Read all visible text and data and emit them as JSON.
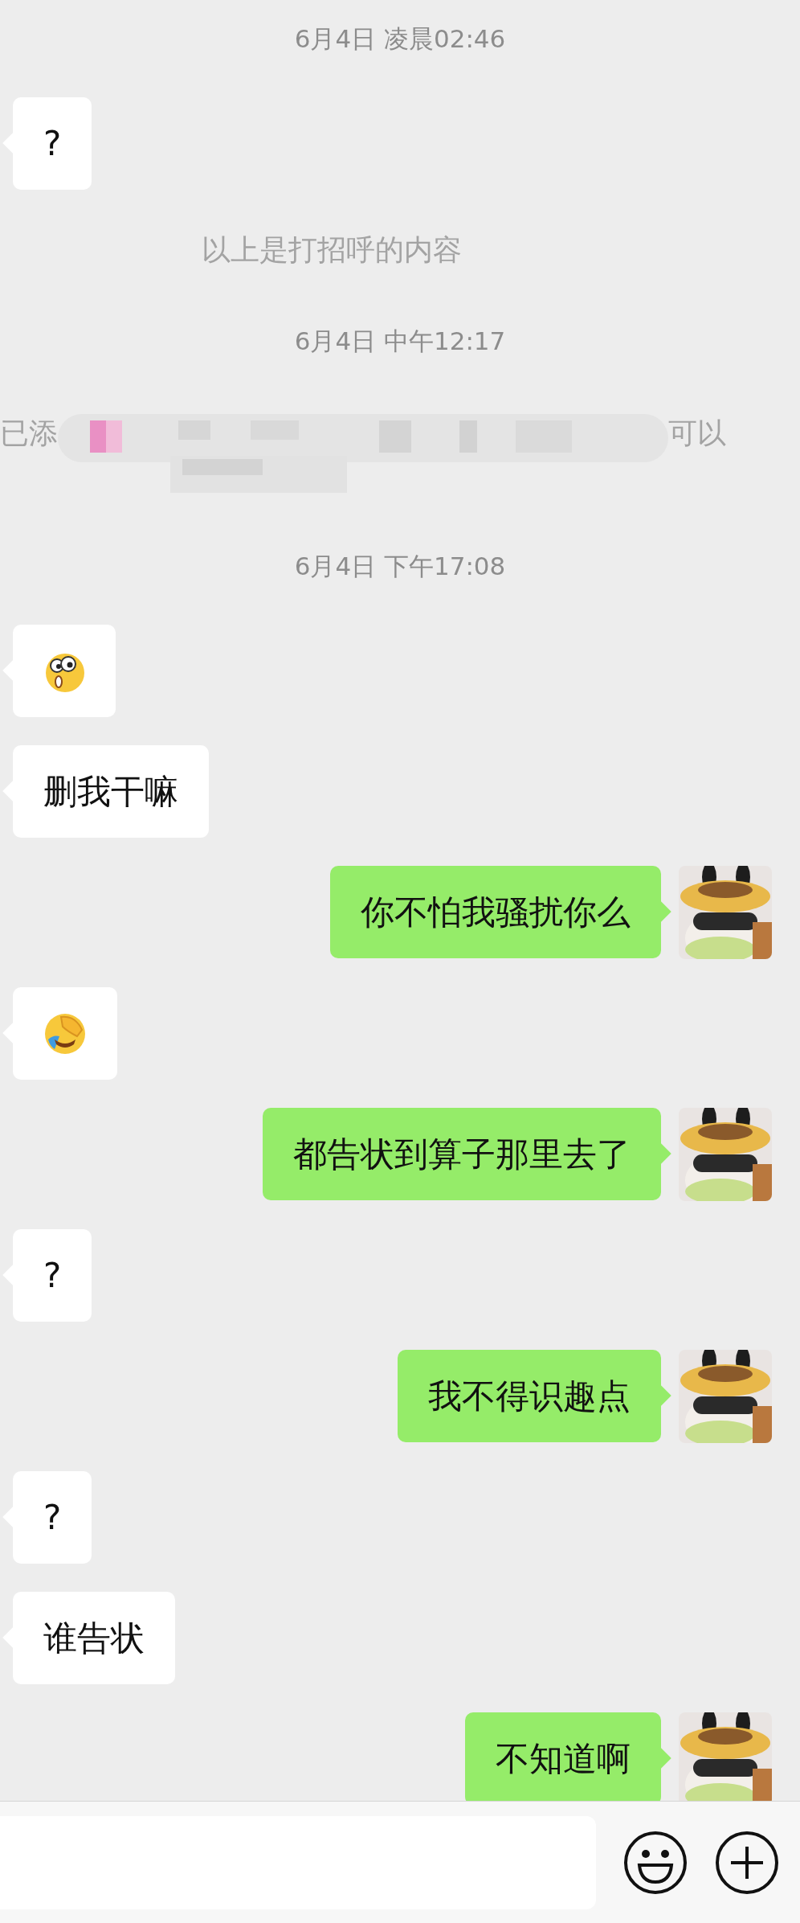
{
  "messages": [
    {
      "kind": "time",
      "text": "6月4日 凌晨02:46"
    },
    {
      "kind": "text",
      "outgoing": false,
      "text": "?"
    },
    {
      "kind": "system",
      "text": "以上是打招呼的内容"
    },
    {
      "kind": "time",
      "text": "6月4日 中午12:17"
    },
    {
      "kind": "redacted",
      "text_start": "已添",
      "text_end": "可以"
    },
    {
      "kind": "time",
      "text": "6月4日 下午17:08"
    },
    {
      "kind": "emoji",
      "outgoing": false
    },
    {
      "kind": "text",
      "outgoing": false,
      "text": "删我干嘛"
    },
    {
      "kind": "text",
      "outgoing": true,
      "text": "你不怕我骚扰你么"
    },
    {
      "kind": "emoji",
      "outgoing": false
    },
    {
      "kind": "text",
      "outgoing": true,
      "text": "都告状到算子那里去了"
    },
    {
      "kind": "text",
      "outgoing": false,
      "text": "?"
    },
    {
      "kind": "text",
      "outgoing": true,
      "text": "我不得识趣点"
    },
    {
      "kind": "text",
      "outgoing": false,
      "text": "?"
    },
    {
      "kind": "text",
      "outgoing": false,
      "text": "谁告状"
    },
    {
      "kind": "text",
      "outgoing": true,
      "text": "不知道啊"
    }
  ]
}
